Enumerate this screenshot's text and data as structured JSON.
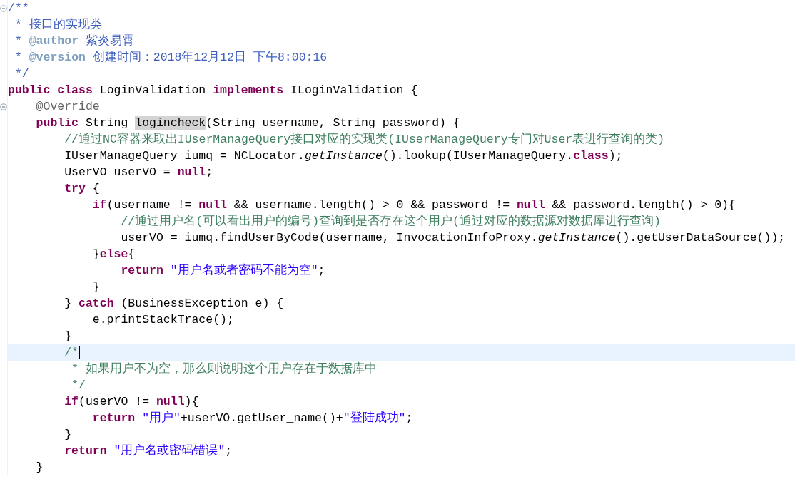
{
  "editor": {
    "lines": [
      {
        "foldable": true,
        "tokens": [
          {
            "kind": "doc",
            "text": "/**"
          }
        ]
      },
      {
        "tokens": [
          {
            "kind": "doc",
            "text": " * 接口的实现类"
          }
        ]
      },
      {
        "tokens": [
          {
            "kind": "doc",
            "text": " * "
          },
          {
            "kind": "doctag",
            "text": "@author"
          },
          {
            "kind": "doc",
            "text": " 紫炎易霄"
          }
        ]
      },
      {
        "tokens": [
          {
            "kind": "doc",
            "text": " * "
          },
          {
            "kind": "doctag",
            "text": "@version"
          },
          {
            "kind": "doc",
            "text": " 创建时间：2018年12月12日 下午8:00:16"
          }
        ]
      },
      {
        "tokens": [
          {
            "kind": "doc",
            "text": " */"
          }
        ]
      },
      {
        "tokens": [
          {
            "kind": "keyword",
            "text": "public class"
          },
          {
            "kind": "plain",
            "text": " LoginValidation "
          },
          {
            "kind": "keyword",
            "text": "implements"
          },
          {
            "kind": "plain",
            "text": " ILoginValidation {"
          }
        ]
      },
      {
        "foldable": true,
        "tokens": [
          {
            "kind": "annotation",
            "text": "    @Override"
          }
        ]
      },
      {
        "tokens": [
          {
            "kind": "keyword",
            "text": "    public"
          },
          {
            "kind": "plain",
            "text": " String "
          },
          {
            "kind": "occurrence",
            "text": "logincheck"
          },
          {
            "kind": "plain",
            "text": "(String username, String password) {"
          }
        ]
      },
      {
        "tokens": [
          {
            "kind": "comment",
            "text": "        //通过NC容器来取出IUserManageQuery接口对应的实现类(IUserManageQuery专门对User表进行查询的类)"
          }
        ]
      },
      {
        "tokens": [
          {
            "kind": "plain",
            "text": "        IUserManageQuery iumq = NCLocator."
          },
          {
            "kind": "italic",
            "text": "getInstance"
          },
          {
            "kind": "plain",
            "text": "().lookup(IUserManageQuery."
          },
          {
            "kind": "keyword",
            "text": "class"
          },
          {
            "kind": "plain",
            "text": ");"
          }
        ]
      },
      {
        "tokens": [
          {
            "kind": "plain",
            "text": "        UserVO userVO = "
          },
          {
            "kind": "keyword",
            "text": "null"
          },
          {
            "kind": "plain",
            "text": ";"
          }
        ]
      },
      {
        "tokens": [
          {
            "kind": "keyword",
            "text": "        try"
          },
          {
            "kind": "plain",
            "text": " {"
          }
        ]
      },
      {
        "tokens": [
          {
            "kind": "keyword",
            "text": "            if"
          },
          {
            "kind": "plain",
            "text": "(username != "
          },
          {
            "kind": "keyword",
            "text": "null"
          },
          {
            "kind": "plain",
            "text": " && username.length() > 0 && password != "
          },
          {
            "kind": "keyword",
            "text": "null"
          },
          {
            "kind": "plain",
            "text": " && password.length() > 0){"
          }
        ]
      },
      {
        "tokens": [
          {
            "kind": "comment",
            "text": "                //通过用户名(可以看出用户的编号)查询到是否存在这个用户(通过对应的数据源对数据库进行查询)"
          }
        ]
      },
      {
        "tokens": [
          {
            "kind": "plain",
            "text": "                userVO = iumq.findUserByCode(username, InvocationInfoProxy."
          },
          {
            "kind": "italic",
            "text": "getInstance"
          },
          {
            "kind": "plain",
            "text": "().getUserDataSource());"
          }
        ]
      },
      {
        "tokens": [
          {
            "kind": "plain",
            "text": "            }"
          },
          {
            "kind": "keyword",
            "text": "else"
          },
          {
            "kind": "plain",
            "text": "{"
          }
        ]
      },
      {
        "tokens": [
          {
            "kind": "keyword",
            "text": "                return"
          },
          {
            "kind": "string",
            "text": " \"用户名或者密码不能为空\""
          },
          {
            "kind": "plain",
            "text": ";"
          }
        ]
      },
      {
        "tokens": [
          {
            "kind": "plain",
            "text": "            }"
          }
        ]
      },
      {
        "tokens": [
          {
            "kind": "plain",
            "text": "        } "
          },
          {
            "kind": "keyword",
            "text": "catch"
          },
          {
            "kind": "plain",
            "text": " (BusinessException e) {"
          }
        ]
      },
      {
        "tokens": [
          {
            "kind": "plain",
            "text": "            e.printStackTrace();"
          }
        ]
      },
      {
        "tokens": [
          {
            "kind": "plain",
            "text": "        }"
          }
        ]
      },
      {
        "current": true,
        "caret": true,
        "tokens": [
          {
            "kind": "comment",
            "text": "        /*"
          }
        ]
      },
      {
        "tokens": [
          {
            "kind": "comment",
            "text": "         * 如果用户不为空，那么则说明这个用户存在于数据库中"
          }
        ]
      },
      {
        "tokens": [
          {
            "kind": "comment",
            "text": "         */"
          }
        ]
      },
      {
        "tokens": [
          {
            "kind": "keyword",
            "text": "        if"
          },
          {
            "kind": "plain",
            "text": "(userVO != "
          },
          {
            "kind": "keyword",
            "text": "null"
          },
          {
            "kind": "plain",
            "text": "){"
          }
        ]
      },
      {
        "tokens": [
          {
            "kind": "keyword",
            "text": "            return"
          },
          {
            "kind": "string",
            "text": " \"用户\""
          },
          {
            "kind": "plain",
            "text": "+userVO.getUser_name()+"
          },
          {
            "kind": "string",
            "text": "\"登陆成功\""
          },
          {
            "kind": "plain",
            "text": ";"
          }
        ]
      },
      {
        "tokens": [
          {
            "kind": "plain",
            "text": "        }"
          }
        ]
      },
      {
        "tokens": [
          {
            "kind": "keyword",
            "text": "        return"
          },
          {
            "kind": "string",
            "text": " \"用户名或密码错误\""
          },
          {
            "kind": "plain",
            "text": ";"
          }
        ]
      },
      {
        "tokens": [
          {
            "kind": "plain",
            "text": "    }"
          }
        ]
      }
    ]
  }
}
